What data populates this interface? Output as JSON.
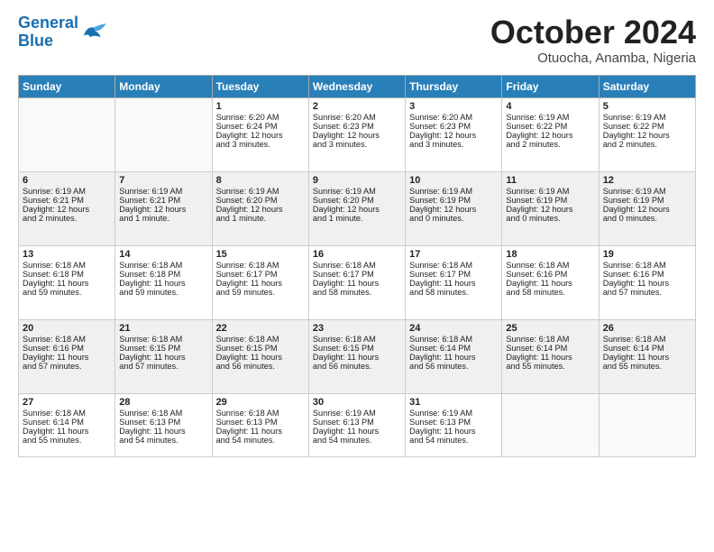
{
  "header": {
    "logo_line1": "General",
    "logo_line2": "Blue",
    "month": "October 2024",
    "location": "Otuocha, Anamba, Nigeria"
  },
  "weekdays": [
    "Sunday",
    "Monday",
    "Tuesday",
    "Wednesday",
    "Thursday",
    "Friday",
    "Saturday"
  ],
  "weeks": [
    [
      {
        "day": "",
        "content": ""
      },
      {
        "day": "",
        "content": ""
      },
      {
        "day": "1",
        "content": "Sunrise: 6:20 AM\nSunset: 6:24 PM\nDaylight: 12 hours\nand 3 minutes."
      },
      {
        "day": "2",
        "content": "Sunrise: 6:20 AM\nSunset: 6:23 PM\nDaylight: 12 hours\nand 3 minutes."
      },
      {
        "day": "3",
        "content": "Sunrise: 6:20 AM\nSunset: 6:23 PM\nDaylight: 12 hours\nand 3 minutes."
      },
      {
        "day": "4",
        "content": "Sunrise: 6:19 AM\nSunset: 6:22 PM\nDaylight: 12 hours\nand 2 minutes."
      },
      {
        "day": "5",
        "content": "Sunrise: 6:19 AM\nSunset: 6:22 PM\nDaylight: 12 hours\nand 2 minutes."
      }
    ],
    [
      {
        "day": "6",
        "content": "Sunrise: 6:19 AM\nSunset: 6:21 PM\nDaylight: 12 hours\nand 2 minutes."
      },
      {
        "day": "7",
        "content": "Sunrise: 6:19 AM\nSunset: 6:21 PM\nDaylight: 12 hours\nand 1 minute."
      },
      {
        "day": "8",
        "content": "Sunrise: 6:19 AM\nSunset: 6:20 PM\nDaylight: 12 hours\nand 1 minute."
      },
      {
        "day": "9",
        "content": "Sunrise: 6:19 AM\nSunset: 6:20 PM\nDaylight: 12 hours\nand 1 minute."
      },
      {
        "day": "10",
        "content": "Sunrise: 6:19 AM\nSunset: 6:19 PM\nDaylight: 12 hours\nand 0 minutes."
      },
      {
        "day": "11",
        "content": "Sunrise: 6:19 AM\nSunset: 6:19 PM\nDaylight: 12 hours\nand 0 minutes."
      },
      {
        "day": "12",
        "content": "Sunrise: 6:19 AM\nSunset: 6:19 PM\nDaylight: 12 hours\nand 0 minutes."
      }
    ],
    [
      {
        "day": "13",
        "content": "Sunrise: 6:18 AM\nSunset: 6:18 PM\nDaylight: 11 hours\nand 59 minutes."
      },
      {
        "day": "14",
        "content": "Sunrise: 6:18 AM\nSunset: 6:18 PM\nDaylight: 11 hours\nand 59 minutes."
      },
      {
        "day": "15",
        "content": "Sunrise: 6:18 AM\nSunset: 6:17 PM\nDaylight: 11 hours\nand 59 minutes."
      },
      {
        "day": "16",
        "content": "Sunrise: 6:18 AM\nSunset: 6:17 PM\nDaylight: 11 hours\nand 58 minutes."
      },
      {
        "day": "17",
        "content": "Sunrise: 6:18 AM\nSunset: 6:17 PM\nDaylight: 11 hours\nand 58 minutes."
      },
      {
        "day": "18",
        "content": "Sunrise: 6:18 AM\nSunset: 6:16 PM\nDaylight: 11 hours\nand 58 minutes."
      },
      {
        "day": "19",
        "content": "Sunrise: 6:18 AM\nSunset: 6:16 PM\nDaylight: 11 hours\nand 57 minutes."
      }
    ],
    [
      {
        "day": "20",
        "content": "Sunrise: 6:18 AM\nSunset: 6:16 PM\nDaylight: 11 hours\nand 57 minutes."
      },
      {
        "day": "21",
        "content": "Sunrise: 6:18 AM\nSunset: 6:15 PM\nDaylight: 11 hours\nand 57 minutes."
      },
      {
        "day": "22",
        "content": "Sunrise: 6:18 AM\nSunset: 6:15 PM\nDaylight: 11 hours\nand 56 minutes."
      },
      {
        "day": "23",
        "content": "Sunrise: 6:18 AM\nSunset: 6:15 PM\nDaylight: 11 hours\nand 56 minutes."
      },
      {
        "day": "24",
        "content": "Sunrise: 6:18 AM\nSunset: 6:14 PM\nDaylight: 11 hours\nand 56 minutes."
      },
      {
        "day": "25",
        "content": "Sunrise: 6:18 AM\nSunset: 6:14 PM\nDaylight: 11 hours\nand 55 minutes."
      },
      {
        "day": "26",
        "content": "Sunrise: 6:18 AM\nSunset: 6:14 PM\nDaylight: 11 hours\nand 55 minutes."
      }
    ],
    [
      {
        "day": "27",
        "content": "Sunrise: 6:18 AM\nSunset: 6:14 PM\nDaylight: 11 hours\nand 55 minutes."
      },
      {
        "day": "28",
        "content": "Sunrise: 6:18 AM\nSunset: 6:13 PM\nDaylight: 11 hours\nand 54 minutes."
      },
      {
        "day": "29",
        "content": "Sunrise: 6:18 AM\nSunset: 6:13 PM\nDaylight: 11 hours\nand 54 minutes."
      },
      {
        "day": "30",
        "content": "Sunrise: 6:19 AM\nSunset: 6:13 PM\nDaylight: 11 hours\nand 54 minutes."
      },
      {
        "day": "31",
        "content": "Sunrise: 6:19 AM\nSunset: 6:13 PM\nDaylight: 11 hours\nand 54 minutes."
      },
      {
        "day": "",
        "content": ""
      },
      {
        "day": "",
        "content": ""
      }
    ]
  ]
}
